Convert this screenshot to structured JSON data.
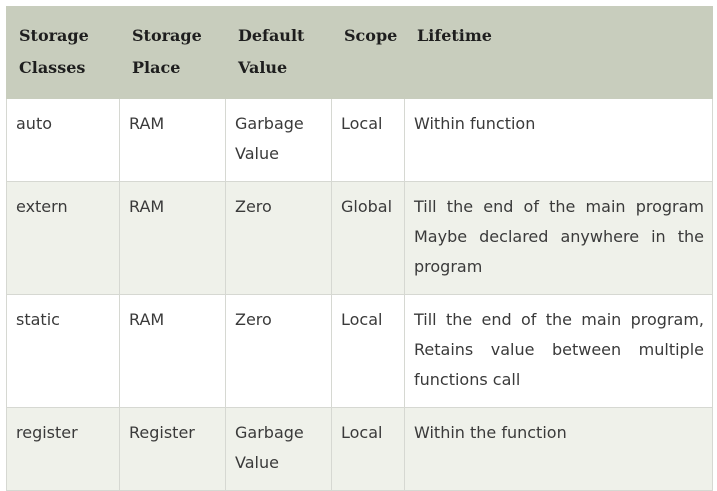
{
  "table": {
    "headers": [
      [
        "Storage",
        "Classes"
      ],
      [
        "Storage",
        "Place"
      ],
      [
        "Default",
        "Value"
      ],
      [
        "Scope"
      ],
      [
        "Lifetime"
      ]
    ],
    "rows": [
      {
        "storage_class": "auto",
        "storage_place": "RAM",
        "default_value": [
          "Garbage",
          "Value"
        ],
        "scope": "Local",
        "lifetime": [
          "Within function"
        ]
      },
      {
        "storage_class": "extern",
        "storage_place": "RAM",
        "default_value": [
          "Zero"
        ],
        "scope": "Global",
        "lifetime": [
          "Till the end of the main program",
          "Maybe declared anywhere in the",
          "program"
        ]
      },
      {
        "storage_class": "static",
        "storage_place": "RAM",
        "default_value": [
          "Zero"
        ],
        "scope": "Local",
        "lifetime": [
          "Till the end of the main program,",
          "Retains value between multiple",
          "functions call"
        ]
      },
      {
        "storage_class": "register",
        "storage_place": "Register",
        "default_value": [
          "Garbage",
          "Value"
        ],
        "scope": "Local",
        "lifetime": [
          "Within the function"
        ]
      }
    ]
  },
  "colors": {
    "header_bg": "#c8cdbd",
    "alt_row_bg": "#eff1ea",
    "border": "#d6d8d2"
  }
}
